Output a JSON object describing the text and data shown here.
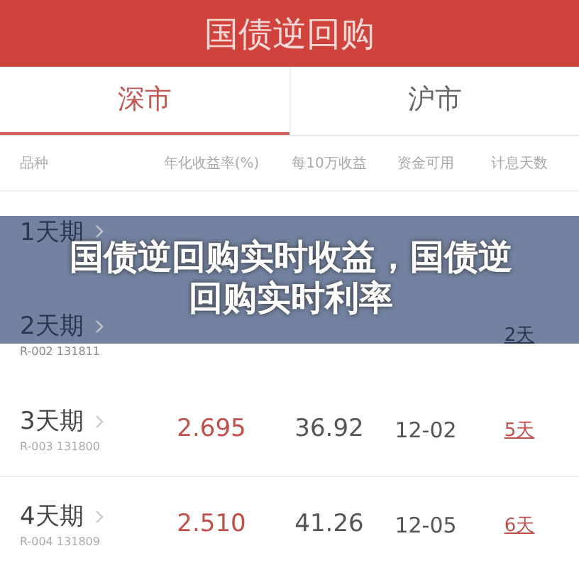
{
  "header": {
    "title": "国债逆回购"
  },
  "tabs": [
    {
      "label": "深市",
      "selected": true
    },
    {
      "label": "沪市",
      "selected": false
    }
  ],
  "table": {
    "columns": [
      "品种",
      "年化收益率(%)",
      "每10万收益",
      "资金可用",
      "计息天数"
    ],
    "rows": [
      {
        "name": "1天期"
      },
      {
        "name": "2天期",
        "code": "R-002 131811",
        "days": "2天"
      },
      {
        "name": "3天期",
        "code": "R-003 131800",
        "rate": "2.695",
        "income": "36.92",
        "available": "12-02",
        "days": "5天"
      },
      {
        "name": "4天期",
        "code": "R-004 131809",
        "rate": "2.510",
        "income": "41.26",
        "available": "12-05",
        "days": "6天"
      }
    ]
  },
  "banner": {
    "text": "国债逆回购实时收益，国债逆回购实时利率"
  }
}
